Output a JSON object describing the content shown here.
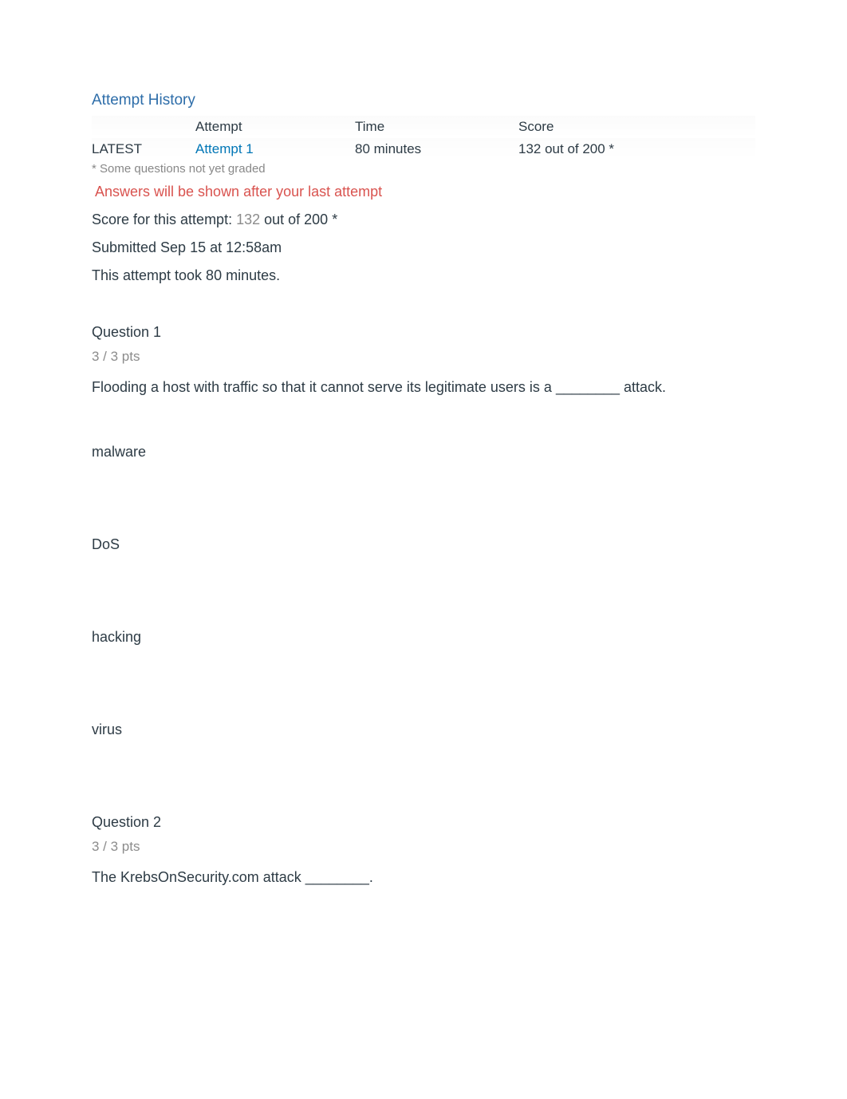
{
  "attempt_history": {
    "title": "Attempt History",
    "headers": {
      "blank": "",
      "attempt": "Attempt",
      "time": "Time",
      "score": "Score"
    },
    "rows": [
      {
        "label": "LATEST",
        "attempt": "Attempt 1",
        "time": "80 minutes",
        "score": "132 out of 200 *"
      }
    ],
    "footnote": "* Some questions not yet graded"
  },
  "notice": "Answers will be shown after your last attempt",
  "score_attempt": {
    "prefix": "Score for this attempt: ",
    "score_value": "132",
    "suffix": " out of 200 *"
  },
  "submitted": "Submitted Sep 15 at 12:58am",
  "duration": "This attempt took 80 minutes.",
  "questions": [
    {
      "title": "Question 1",
      "pts": "3 / 3 pts",
      "text": "Flooding a host with traffic so that it cannot serve its legitimate users is a ________ attack.",
      "options": [
        "malware",
        "DoS",
        "hacking",
        "virus"
      ]
    },
    {
      "title": "Question 2",
      "pts": "3 / 3 pts",
      "text": "The KrebsOnSecurity.com attack ________.",
      "options": []
    }
  ]
}
